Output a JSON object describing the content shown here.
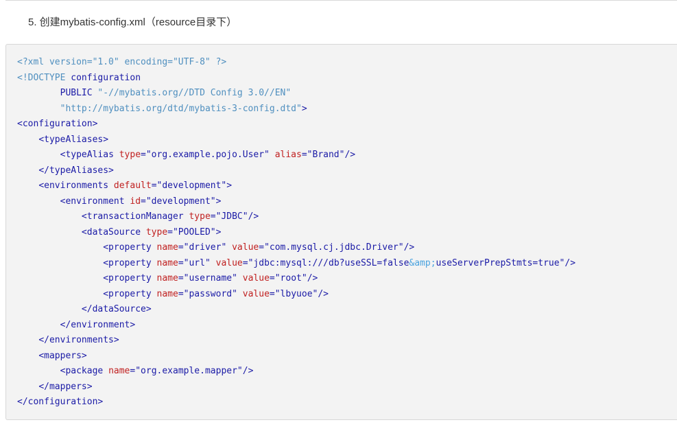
{
  "heading": "5. 创建mybatis-config.xml（resource目录下）",
  "colors": {
    "meta": "#4f8fbf",
    "tag": "#1a1aa6",
    "attribute": "#c02020",
    "string": "#1a1aa6",
    "entity": "#4aa3df",
    "background": "#f3f3f3"
  },
  "code": {
    "language": "xml",
    "lines": [
      {
        "indent": 0,
        "tokens": [
          {
            "t": "meta",
            "v": "<?xml version=\"1.0\" encoding=\"UTF-8\" ?>"
          }
        ]
      },
      {
        "indent": 0,
        "tokens": [
          {
            "t": "meta",
            "v": "<!DOCTYPE "
          },
          {
            "t": "tag",
            "v": "configuration"
          }
        ]
      },
      {
        "indent": 8,
        "tokens": [
          {
            "t": "tag",
            "v": "PUBLIC "
          },
          {
            "t": "meta",
            "v": "\"-//mybatis.org//DTD Config 3.0//EN\""
          }
        ]
      },
      {
        "indent": 8,
        "tokens": [
          {
            "t": "meta",
            "v": "\"http://mybatis.org/dtd/mybatis-3-config.dtd\""
          },
          {
            "t": "tag",
            "v": ">"
          }
        ]
      },
      {
        "indent": 0,
        "tokens": [
          {
            "t": "tag",
            "v": "<configuration>"
          }
        ]
      },
      {
        "indent": 4,
        "tokens": [
          {
            "t": "tag",
            "v": "<typeAliases>"
          }
        ]
      },
      {
        "indent": 8,
        "tokens": [
          {
            "t": "tag",
            "v": "<typeAlias "
          },
          {
            "t": "attr",
            "v": "type"
          },
          {
            "t": "tag",
            "v": "="
          },
          {
            "t": "str",
            "v": "\"org.example.pojo.User\""
          },
          {
            "t": "tag",
            "v": " "
          },
          {
            "t": "attr",
            "v": "alias"
          },
          {
            "t": "tag",
            "v": "="
          },
          {
            "t": "str",
            "v": "\"Brand\""
          },
          {
            "t": "tag",
            "v": "/>"
          }
        ]
      },
      {
        "indent": 4,
        "tokens": [
          {
            "t": "tag",
            "v": "</typeAliases>"
          }
        ]
      },
      {
        "indent": 4,
        "tokens": [
          {
            "t": "tag",
            "v": "<environments "
          },
          {
            "t": "attr",
            "v": "default"
          },
          {
            "t": "tag",
            "v": "="
          },
          {
            "t": "str",
            "v": "\"development\""
          },
          {
            "t": "tag",
            "v": ">"
          }
        ]
      },
      {
        "indent": 8,
        "tokens": [
          {
            "t": "tag",
            "v": "<environment "
          },
          {
            "t": "attr",
            "v": "id"
          },
          {
            "t": "tag",
            "v": "="
          },
          {
            "t": "str",
            "v": "\"development\""
          },
          {
            "t": "tag",
            "v": ">"
          }
        ]
      },
      {
        "indent": 12,
        "tokens": [
          {
            "t": "tag",
            "v": "<transactionManager "
          },
          {
            "t": "attr",
            "v": "type"
          },
          {
            "t": "tag",
            "v": "="
          },
          {
            "t": "str",
            "v": "\"JDBC\""
          },
          {
            "t": "tag",
            "v": "/>"
          }
        ]
      },
      {
        "indent": 12,
        "tokens": [
          {
            "t": "tag",
            "v": "<dataSource "
          },
          {
            "t": "attr",
            "v": "type"
          },
          {
            "t": "tag",
            "v": "="
          },
          {
            "t": "str",
            "v": "\"POOLED\""
          },
          {
            "t": "tag",
            "v": ">"
          }
        ]
      },
      {
        "indent": 16,
        "tokens": [
          {
            "t": "tag",
            "v": "<property "
          },
          {
            "t": "attr",
            "v": "name"
          },
          {
            "t": "tag",
            "v": "="
          },
          {
            "t": "str",
            "v": "\"driver\""
          },
          {
            "t": "tag",
            "v": " "
          },
          {
            "t": "attr",
            "v": "value"
          },
          {
            "t": "tag",
            "v": "="
          },
          {
            "t": "str",
            "v": "\"com.mysql.cj.jdbc.Driver\""
          },
          {
            "t": "tag",
            "v": "/>"
          }
        ]
      },
      {
        "indent": 16,
        "tokens": [
          {
            "t": "tag",
            "v": "<property "
          },
          {
            "t": "attr",
            "v": "name"
          },
          {
            "t": "tag",
            "v": "="
          },
          {
            "t": "str",
            "v": "\"url\""
          },
          {
            "t": "tag",
            "v": " "
          },
          {
            "t": "attr",
            "v": "value"
          },
          {
            "t": "tag",
            "v": "="
          },
          {
            "t": "str",
            "v": "\"jdbc:mysql:///db?useSSL=false"
          },
          {
            "t": "ent",
            "v": "&amp;"
          },
          {
            "t": "str",
            "v": "useServerPrepStmts=true\""
          },
          {
            "t": "tag",
            "v": "/>"
          }
        ]
      },
      {
        "indent": 16,
        "tokens": [
          {
            "t": "tag",
            "v": "<property "
          },
          {
            "t": "attr",
            "v": "name"
          },
          {
            "t": "tag",
            "v": "="
          },
          {
            "t": "str",
            "v": "\"username\""
          },
          {
            "t": "tag",
            "v": " "
          },
          {
            "t": "attr",
            "v": "value"
          },
          {
            "t": "tag",
            "v": "="
          },
          {
            "t": "str",
            "v": "\"root\""
          },
          {
            "t": "tag",
            "v": "/>"
          }
        ]
      },
      {
        "indent": 16,
        "tokens": [
          {
            "t": "tag",
            "v": "<property "
          },
          {
            "t": "attr",
            "v": "name"
          },
          {
            "t": "tag",
            "v": "="
          },
          {
            "t": "str",
            "v": "\"password\""
          },
          {
            "t": "tag",
            "v": " "
          },
          {
            "t": "attr",
            "v": "value"
          },
          {
            "t": "tag",
            "v": "="
          },
          {
            "t": "str",
            "v": "\"lbyuoe\""
          },
          {
            "t": "tag",
            "v": "/>"
          }
        ]
      },
      {
        "indent": 12,
        "tokens": [
          {
            "t": "tag",
            "v": "</dataSource>"
          }
        ]
      },
      {
        "indent": 8,
        "tokens": [
          {
            "t": "tag",
            "v": "</environment>"
          }
        ]
      },
      {
        "indent": 4,
        "tokens": [
          {
            "t": "tag",
            "v": "</environments>"
          }
        ]
      },
      {
        "indent": 4,
        "tokens": [
          {
            "t": "tag",
            "v": "<mappers>"
          }
        ]
      },
      {
        "indent": 8,
        "tokens": [
          {
            "t": "tag",
            "v": "<package "
          },
          {
            "t": "attr",
            "v": "name"
          },
          {
            "t": "tag",
            "v": "="
          },
          {
            "t": "str",
            "v": "\"org.example.mapper\""
          },
          {
            "t": "tag",
            "v": "/>"
          }
        ]
      },
      {
        "indent": 4,
        "tokens": [
          {
            "t": "tag",
            "v": "</mappers>"
          }
        ]
      },
      {
        "indent": 0,
        "tokens": [
          {
            "t": "tag",
            "v": "</configuration>"
          }
        ]
      }
    ]
  }
}
